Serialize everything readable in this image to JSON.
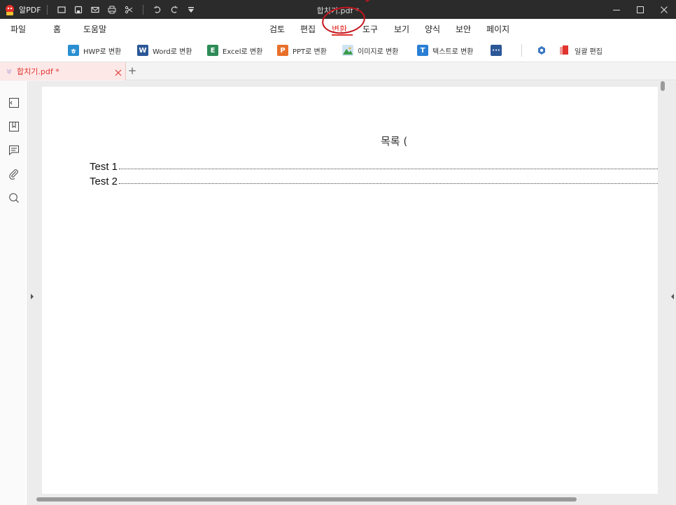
{
  "titlebar": {
    "app_name": "알PDF",
    "document_title": "합치기.pdf *"
  },
  "menu": {
    "left": [
      "파일",
      "홈",
      "도움말"
    ],
    "center": [
      "검토",
      "편집",
      "변환",
      "도구",
      "보기",
      "양식",
      "보안",
      "페이지"
    ],
    "active": "변환"
  },
  "toolbar": {
    "hwp": "HWP로 변환",
    "word": "Word로 변환",
    "excel": "Excel로 변환",
    "ppt": "PPT로 변환",
    "image": "이미지로 변환",
    "text": "텍스트로 변환",
    "batch": "일괄 편집"
  },
  "tabs": [
    {
      "label": "합치기.pdf *",
      "active": true
    }
  ],
  "document": {
    "toc_title": "목록 (",
    "entries": [
      "Test 1",
      "Test 2"
    ]
  },
  "colors": {
    "accent": "#e0342f",
    "hwp": "#2a8fd0",
    "word": "#2b5797",
    "excel": "#2e8b57",
    "ppt": "#e8702a",
    "text": "#2a7fd4"
  }
}
